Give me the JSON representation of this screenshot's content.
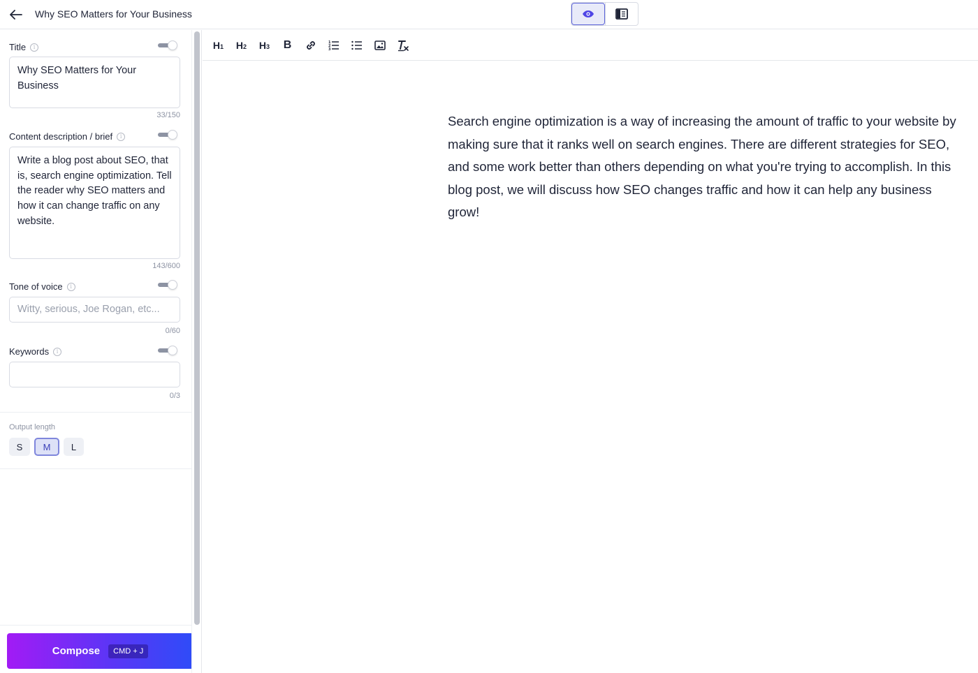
{
  "header": {
    "title": "Why SEO Matters for Your Business"
  },
  "form": {
    "title": {
      "label": "Title",
      "value": "Why SEO Matters for Your Business",
      "counter": "33/150"
    },
    "description": {
      "label": "Content description / brief",
      "value": "Write a blog post about SEO, that is, search engine optimization. Tell the reader why SEO matters and how it can change traffic on any website.",
      "counter": "143/600"
    },
    "tone": {
      "label": "Tone of voice",
      "placeholder": "Witty, serious, Joe Rogan, etc...",
      "counter": "0/60"
    },
    "keywords": {
      "label": "Keywords",
      "value": "",
      "counter": "0/3"
    },
    "output_length": {
      "label": "Output length",
      "options": [
        "S",
        "M",
        "L"
      ],
      "selected": "M"
    }
  },
  "compose": {
    "label": "Compose",
    "shortcut": "CMD + J"
  },
  "toolbar": {
    "h1": "H",
    "h1_sub": "1",
    "h2": "H",
    "h2_sub": "2",
    "h3": "H",
    "h3_sub": "3",
    "bold": "B"
  },
  "editor": {
    "content": "Search engine optimization is a way of increasing the amount of traffic to your website by making sure that it ranks well on search engines. There are different strategies for SEO, and some work better than others depending on what you're trying to accomplish. In this blog post, we will discuss how SEO changes traffic and how it can help any business grow!"
  },
  "colors": {
    "accent": "#5b62d9",
    "compose_gradient_start": "#a21bf5",
    "compose_gradient_end": "#2e4cf8"
  }
}
